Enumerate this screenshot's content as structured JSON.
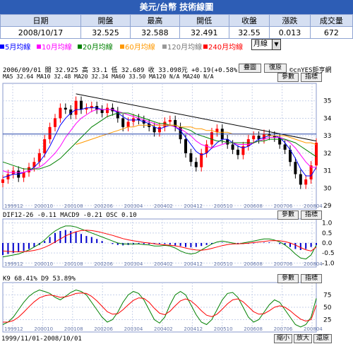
{
  "title": "美元/台幣  技術線圖",
  "quote": {
    "headers": [
      "日期",
      "開盤",
      "最高",
      "開低",
      "收盤",
      "漲跌",
      "成交量"
    ],
    "values": [
      "2008/10/17",
      "32.525",
      "32.588",
      "32.491",
      "32.55",
      "0.013",
      "672"
    ]
  },
  "ma_legend": [
    {
      "label": "5月均線",
      "color": "#0000ff"
    },
    {
      "label": "10月均線",
      "color": "#ff00ff"
    },
    {
      "label": "20月均線",
      "color": "#008000"
    },
    {
      "label": "60月均線",
      "color": "#ff9900"
    },
    {
      "label": "120月均線",
      "color": "#999999"
    },
    {
      "label": "240月均線",
      "color": "#ff0000"
    }
  ],
  "period_select": "月線",
  "buttons": {
    "overlay": "疊圖",
    "restore": "復原",
    "param": "參數",
    "indicator": "指標",
    "shrink": "縮小",
    "enlarge": "放大",
    "reset": "還原"
  },
  "info": {
    "price_line": "2006/09/01 開 32.925 高 33.1 低 32.689 收 33.098元 +0.19(+0.58%)",
    "ma_line": "MA5 32.64  MA10 32.48  MA20 32.34  MA60 33.50  MA120 N/A  MA240 N/A",
    "copyright": "©cnYES鉅亨網",
    "macd_line": "DIF12-26 -0.11  MACD9 -0.21  OSC 0.10",
    "kd_line": "K9 68.41%  D9 53.89%"
  },
  "footer": "1999/11/01-2008/10/01",
  "chart_data": {
    "type": "line",
    "x_ticks": [
      "199912",
      "200010",
      "200108",
      "200206",
      "200304",
      "200402",
      "200412",
      "200510",
      "200608",
      "200706",
      "200804"
    ],
    "price_axis": [
      35,
      34,
      33,
      32,
      31,
      30,
      29
    ],
    "macd_axis": [
      1.0,
      0.5,
      0.0,
      -0.5,
      -1.0
    ],
    "kd_axis": [
      75,
      50,
      25
    ],
    "price": [
      30.5,
      30.8,
      31.0,
      30.6,
      30.9,
      31.2,
      31.5,
      32.0,
      32.8,
      33.5,
      34.0,
      34.6,
      34.5,
      34.2,
      35.0,
      34.5,
      34.6,
      34.7,
      34.5,
      34.3,
      34.6,
      34.4,
      34.0,
      33.5,
      33.8,
      34.0,
      33.9,
      33.7,
      33.5,
      33.2,
      33.5,
      33.8,
      33.9,
      33.5,
      32.8,
      32.0,
      31.5,
      31.2,
      32.0,
      32.5,
      33.2,
      33.4,
      32.8,
      32.5,
      32.2,
      31.9,
      32.4,
      32.8,
      33.0,
      32.8,
      33.1,
      33.0,
      32.9,
      32.5,
      32.2,
      31.5,
      30.8,
      30.2,
      30.5,
      31.3,
      32.6
    ],
    "ma5": [
      30.6,
      30.7,
      30.8,
      30.8,
      30.9,
      31.0,
      31.2,
      31.5,
      31.9,
      32.4,
      33.0,
      33.6,
      34.0,
      34.3,
      34.5,
      34.5,
      34.6,
      34.6,
      34.6,
      34.5,
      34.5,
      34.5,
      34.3,
      34.1,
      33.9,
      33.9,
      33.9,
      33.8,
      33.7,
      33.5,
      33.4,
      33.5,
      33.6,
      33.5,
      33.3,
      32.9,
      32.5,
      32.1,
      31.9,
      32.0,
      32.3,
      32.6,
      32.8,
      32.8,
      32.6,
      32.4,
      32.3,
      32.4,
      32.6,
      32.8,
      32.9,
      33.0,
      33.0,
      32.9,
      32.6,
      32.2,
      31.7,
      31.1,
      30.7,
      30.7,
      31.2
    ],
    "ma10": [
      31.0,
      30.9,
      30.9,
      30.9,
      30.9,
      31.0,
      31.1,
      31.2,
      31.4,
      31.7,
      32.0,
      32.4,
      32.9,
      33.3,
      33.7,
      34.0,
      34.2,
      34.4,
      34.5,
      34.5,
      34.5,
      34.5,
      34.4,
      34.3,
      34.2,
      34.1,
      34.0,
      33.9,
      33.8,
      33.7,
      33.6,
      33.6,
      33.6,
      33.5,
      33.4,
      33.2,
      33.0,
      32.7,
      32.5,
      32.4,
      32.3,
      32.4,
      32.5,
      32.6,
      32.6,
      32.5,
      32.5,
      32.5,
      32.6,
      32.7,
      32.8,
      32.9,
      32.9,
      32.9,
      32.8,
      32.6,
      32.3,
      31.9,
      31.5,
      31.2,
      31.2
    ],
    "ma20": [
      31.5,
      31.4,
      31.3,
      31.2,
      31.1,
      31.1,
      31.1,
      31.1,
      31.2,
      31.3,
      31.5,
      31.7,
      32.0,
      32.3,
      32.6,
      32.9,
      33.2,
      33.5,
      33.7,
      33.9,
      34.1,
      34.2,
      34.3,
      34.3,
      34.3,
      34.2,
      34.1,
      34.0,
      33.9,
      33.8,
      33.7,
      33.7,
      33.6,
      33.6,
      33.5,
      33.4,
      33.3,
      33.1,
      33.0,
      32.9,
      32.8,
      32.7,
      32.7,
      32.6,
      32.6,
      32.6,
      32.6,
      32.6,
      32.6,
      32.7,
      32.7,
      32.8,
      32.8,
      32.8,
      32.8,
      32.7,
      32.6,
      32.4,
      32.2,
      32.0,
      31.8
    ],
    "ma60": [
      null,
      null,
      null,
      null,
      null,
      null,
      null,
      null,
      null,
      null,
      null,
      null,
      null,
      null,
      32.5,
      32.6,
      32.7,
      32.8,
      32.9,
      33.0,
      33.1,
      33.2,
      33.3,
      33.4,
      33.5,
      33.5,
      33.6,
      33.6,
      33.6,
      33.6,
      33.6,
      33.6,
      33.6,
      33.6,
      33.5,
      33.5,
      33.5,
      33.4,
      33.4,
      33.3,
      33.3,
      33.2,
      33.2,
      33.2,
      33.1,
      33.1,
      33.1,
      33.1,
      33.1,
      33.1,
      33.1,
      33.0,
      33.0,
      33.0,
      33.0,
      32.9,
      32.8,
      32.7,
      32.6,
      32.6,
      32.5
    ],
    "trendline": {
      "from": 35.4,
      "to": 32.7
    },
    "macd_hist": [
      -0.6,
      -0.55,
      -0.5,
      -0.45,
      -0.4,
      -0.3,
      -0.2,
      -0.1,
      0.1,
      0.3,
      0.5,
      0.6,
      0.65,
      0.6,
      0.55,
      0.45,
      0.35,
      0.3,
      0.2,
      0.1,
      0.0,
      -0.05,
      -0.1,
      -0.12,
      -0.1,
      -0.08,
      -0.05,
      -0.05,
      -0.06,
      -0.05,
      -0.04,
      -0.05,
      -0.08,
      -0.12,
      -0.15,
      -0.2,
      -0.22,
      -0.2,
      -0.15,
      -0.1,
      -0.05,
      0.0,
      0.02,
      0.0,
      -0.02,
      -0.05,
      -0.05,
      -0.04,
      -0.02,
      0.0,
      0.02,
      0.03,
      0.0,
      -0.05,
      -0.1,
      -0.2,
      -0.3,
      -0.35,
      -0.3,
      -0.2,
      -0.1
    ],
    "dif": [
      -0.7,
      -0.65,
      -0.6,
      -0.55,
      -0.45,
      -0.35,
      -0.2,
      -0.05,
      0.15,
      0.4,
      0.6,
      0.75,
      0.85,
      0.85,
      0.8,
      0.7,
      0.6,
      0.5,
      0.4,
      0.3,
      0.2,
      0.1,
      0.0,
      -0.05,
      -0.05,
      -0.05,
      -0.05,
      -0.08,
      -0.1,
      -0.15,
      -0.15,
      -0.12,
      -0.15,
      -0.25,
      -0.4,
      -0.5,
      -0.55,
      -0.5,
      -0.35,
      -0.2,
      -0.05,
      0.05,
      0.1,
      0.05,
      0.0,
      -0.05,
      0.0,
      0.05,
      0.1,
      0.15,
      0.2,
      0.2,
      0.15,
      0.05,
      -0.1,
      -0.3,
      -0.55,
      -0.75,
      -0.8,
      -0.6,
      -0.11
    ],
    "macd": [
      -0.4,
      -0.42,
      -0.43,
      -0.44,
      -0.43,
      -0.41,
      -0.37,
      -0.31,
      -0.22,
      -0.1,
      0.05,
      0.2,
      0.35,
      0.47,
      0.56,
      0.62,
      0.64,
      0.62,
      0.58,
      0.52,
      0.45,
      0.38,
      0.3,
      0.22,
      0.16,
      0.11,
      0.07,
      0.03,
      0.0,
      -0.04,
      -0.07,
      -0.09,
      -0.11,
      -0.14,
      -0.19,
      -0.25,
      -0.31,
      -0.35,
      -0.36,
      -0.33,
      -0.27,
      -0.2,
      -0.13,
      -0.08,
      -0.05,
      -0.04,
      -0.03,
      -0.01,
      0.02,
      0.05,
      0.08,
      0.11,
      0.12,
      0.11,
      0.07,
      0.0,
      -0.1,
      -0.23,
      -0.34,
      -0.4,
      -0.21
    ],
    "k": [
      15,
      20,
      30,
      45,
      60,
      72,
      80,
      85,
      82,
      78,
      70,
      65,
      72,
      80,
      85,
      82,
      75,
      60,
      45,
      30,
      20,
      25,
      40,
      60,
      75,
      82,
      78,
      65,
      45,
      25,
      18,
      30,
      55,
      75,
      82,
      75,
      55,
      35,
      20,
      15,
      25,
      45,
      65,
      78,
      80,
      70,
      50,
      30,
      20,
      25,
      40,
      55,
      65,
      60,
      45,
      30,
      15,
      10,
      15,
      30,
      68
    ],
    "d": [
      20,
      20,
      23,
      30,
      40,
      51,
      61,
      69,
      73,
      75,
      73,
      70,
      71,
      74,
      78,
      79,
      78,
      72,
      63,
      52,
      41,
      36,
      37,
      45,
      55,
      64,
      69,
      68,
      60,
      48,
      38,
      35,
      42,
      53,
      63,
      67,
      63,
      54,
      43,
      34,
      31,
      36,
      46,
      57,
      65,
      67,
      61,
      51,
      41,
      36,
      37,
      43,
      50,
      53,
      50,
      43,
      34,
      26,
      22,
      25,
      54
    ]
  }
}
